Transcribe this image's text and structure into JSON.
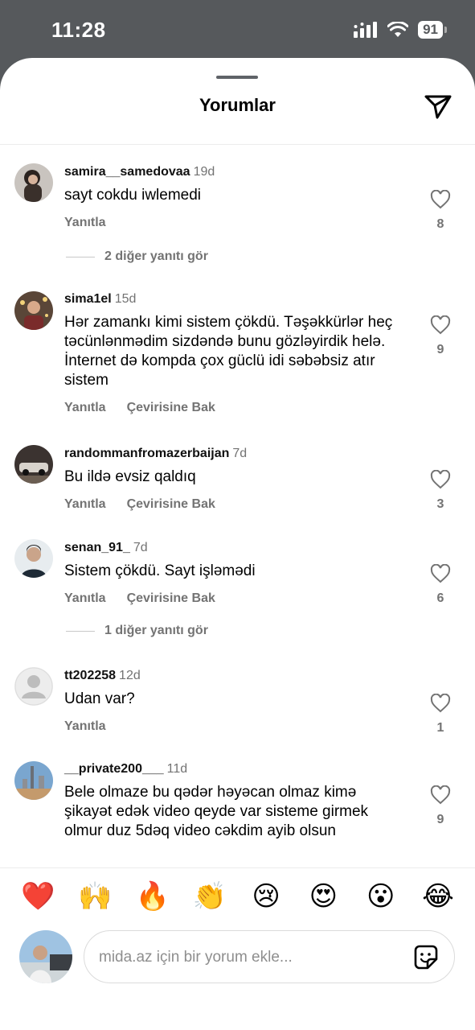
{
  "status_bar": {
    "time": "11:28",
    "battery": "91"
  },
  "sheet": {
    "title": "Yorumlar"
  },
  "comments": [
    {
      "user": "samira__samedovaa",
      "time": "19d",
      "text": "sayt cokdu iwlemedi",
      "likes": "8",
      "actions": [
        "Yanıtla"
      ],
      "replies": "2 diğer yanıtı gör"
    },
    {
      "user": "sima1el",
      "time": "15d",
      "text": "Hər zamankı kimi sistem çökdü. Təşəkkürlər heç təcünlənmədim sizdəndə bunu gözləyirdik helə. İnternet də kompda çox güclü idi səbəbsiz atır sistem",
      "likes": "9",
      "actions": [
        "Yanıtla",
        "Çevirisine Bak"
      ]
    },
    {
      "user": "randommanfromazerbaijan",
      "time": "7d",
      "text": "Bu ildə evsiz qaldıq",
      "likes": "3",
      "actions": [
        "Yanıtla",
        "Çevirisine Bak"
      ]
    },
    {
      "user": "senan_91_",
      "time": "7d",
      "text": "Sistem çökdü. Sayt işləmədi",
      "likes": "6",
      "actions": [
        "Yanıtla",
        "Çevirisine Bak"
      ],
      "replies": "1 diğer yanıtı gör"
    },
    {
      "user": "tt202258",
      "time": "12d",
      "text": "Udan var?",
      "likes": "1",
      "actions": [
        "Yanıtla"
      ]
    },
    {
      "user": "__private200___",
      "time": "11d",
      "text": "Bele olmaze bu qədər həyəcan olmaz kimə şikayət edək video qeyde var sisteme girmek olmur duz 5dəq video cəkdim ayib olsun",
      "likes": "9",
      "actions": []
    }
  ],
  "emoji_bar": [
    "❤️",
    "🙌",
    "🔥",
    "👏",
    "😢",
    "😍",
    "😮",
    "😂"
  ],
  "composer": {
    "placeholder": "mida.az için bir yorum ekle..."
  },
  "colors": {
    "header_bg": "#56595c",
    "muted": "#737373"
  }
}
